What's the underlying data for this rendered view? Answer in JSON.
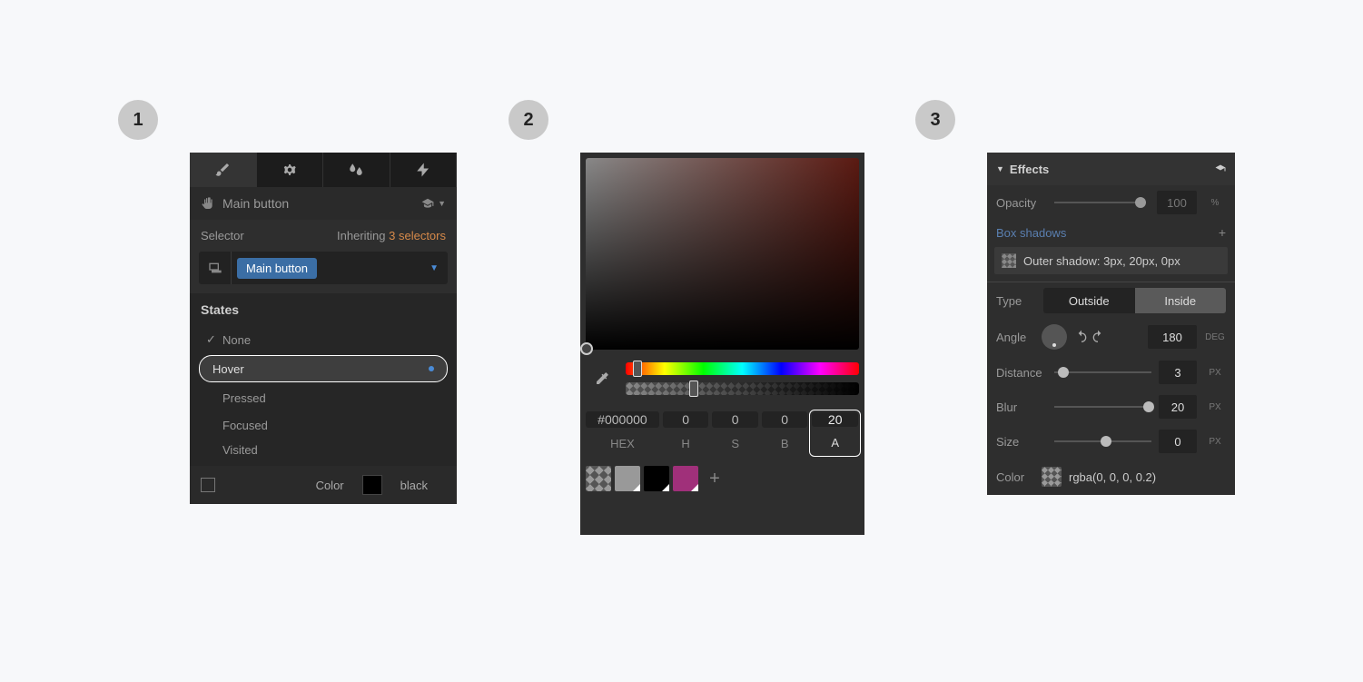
{
  "steps": {
    "s1": "1",
    "s2": "2",
    "s3": "3"
  },
  "panel1": {
    "element_name": "Main button",
    "selector_label": "Selector",
    "inheriting_label": "Inheriting",
    "inheriting_count": "3 selectors",
    "chip": "Main button",
    "states_header": "States",
    "states": {
      "none": "None",
      "hover": "Hover",
      "pressed": "Pressed",
      "focused": "Focused",
      "visited": "Visited"
    },
    "color_label": "Color",
    "color_value": "black"
  },
  "panel2": {
    "hex": "#000000",
    "h": "0",
    "s": "0",
    "b": "0",
    "a": "20",
    "labels": {
      "hex": "HEX",
      "h": "H",
      "s": "S",
      "b": "B",
      "a": "A"
    },
    "swatches": [
      {
        "kind": "checker"
      },
      {
        "kind": "grey",
        "color": "#999"
      },
      {
        "kind": "solid",
        "color": "#000"
      },
      {
        "kind": "solid",
        "color": "#a0307a"
      }
    ]
  },
  "panel3": {
    "title": "Effects",
    "opacity_label": "Opacity",
    "opacity_value": "100",
    "opacity_unit": "%",
    "box_shadows_label": "Box shadows",
    "shadow_item": "Outer shadow: 3px, 20px, 0px",
    "type_label": "Type",
    "outside": "Outside",
    "inside": "Inside",
    "angle_label": "Angle",
    "angle_value": "180",
    "angle_unit": "DEG",
    "distance_label": "Distance",
    "distance_value": "3",
    "blur_label": "Blur",
    "blur_value": "20",
    "size_label": "Size",
    "size_value": "0",
    "px": "PX",
    "color_label": "Color",
    "color_value": "rgba(0, 0, 0, 0.2)"
  }
}
